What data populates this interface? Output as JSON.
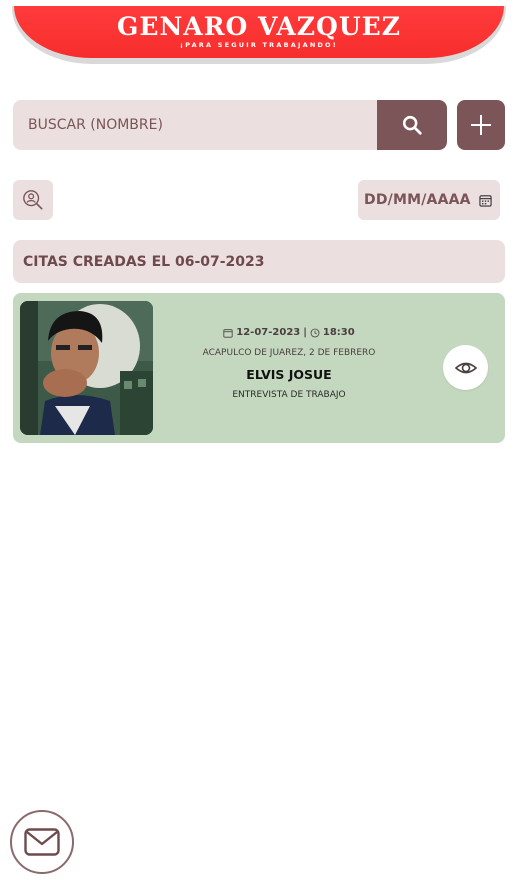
{
  "header": {
    "brand_title": "GENARO VAZQUEZ",
    "brand_subtitle": "¡PARA SEGUIR TRABAJANDO!"
  },
  "search": {
    "placeholder": "BUSCAR (NOMBRE)",
    "value": ""
  },
  "icons": {
    "search": "search-icon",
    "add": "plus-icon",
    "profile_filter": "user-search-icon",
    "calendar": "calendar-icon",
    "clock": "clock-icon",
    "view": "eye-icon",
    "mail": "mail-icon"
  },
  "filters": {
    "date_placeholder": "DD/MM/AAAA"
  },
  "section": {
    "title": "CITAS CREADAS EL 06-07-2023"
  },
  "appointments": [
    {
      "date": "12-07-2023",
      "separator": "|",
      "time": "18:30",
      "location": "ACAPULCO DE JUAREZ, 2 DE FEBRERO",
      "name": "ELVIS JOSUE",
      "type": "ENTREVISTA DE TRABAJO"
    }
  ],
  "colors": {
    "brand_red": "#f72d2d",
    "accent": "#7c5559",
    "field_bg": "#ecdfdf",
    "card_bg": "#c4d8bf"
  }
}
